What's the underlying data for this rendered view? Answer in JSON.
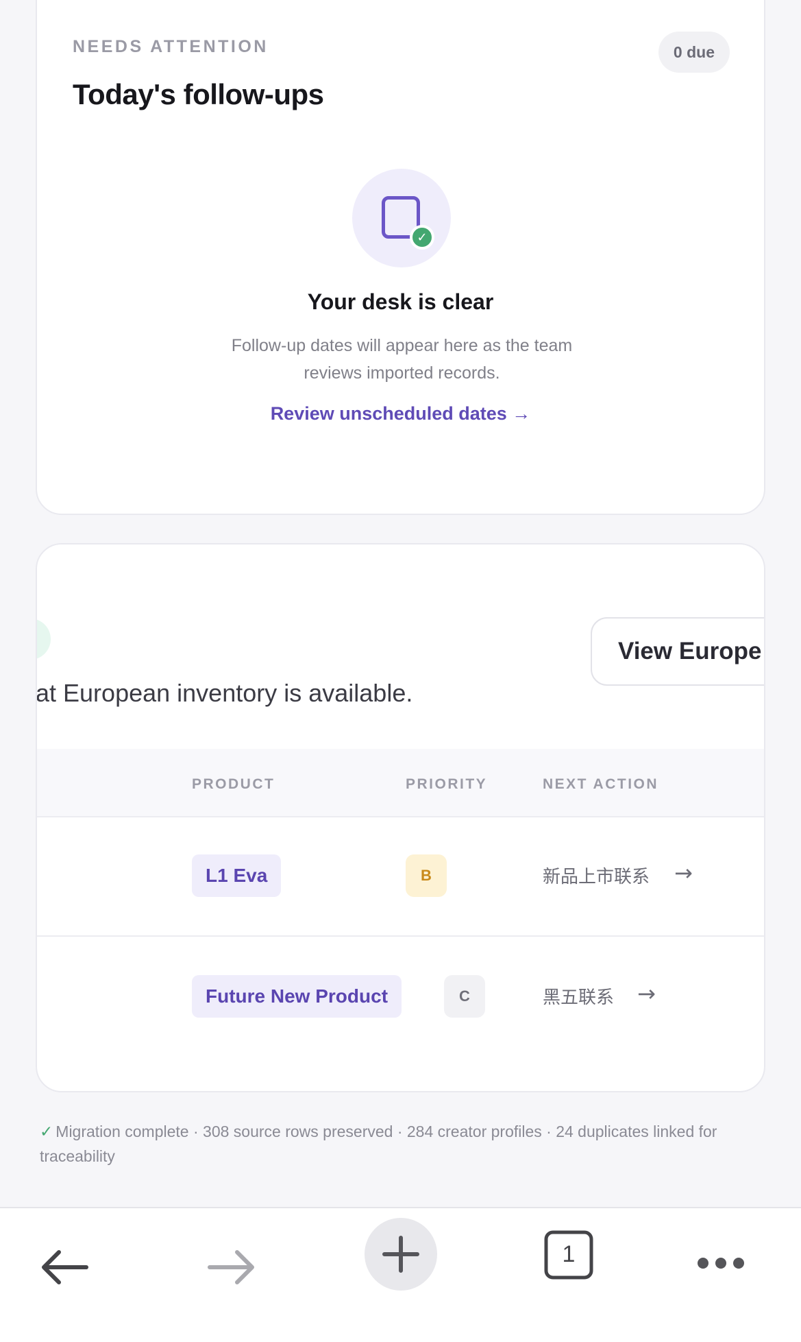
{
  "followups": {
    "eyebrow": "NEEDS ATTENTION",
    "title": "Today's follow-ups",
    "due_badge": "0 due",
    "empty_title": "Your desk is clear",
    "empty_text": "Follow-up dates will appear here as the team reviews imported records.",
    "review_link": "Review unscheduled dates →"
  },
  "europe": {
    "view_button": "View Europe →",
    "notice": "at European inventory is available."
  },
  "table": {
    "headers": {
      "product": "PRODUCT",
      "priority": "PRIORITY",
      "next_action": "NEXT ACTION"
    },
    "rows": [
      {
        "product": "L1 Eva",
        "priority": "B",
        "next_action": "新品上市联系",
        "arrow": "→"
      },
      {
        "product": "Future New Product",
        "priority": "C",
        "next_action": "黑五联系",
        "arrow": "→"
      }
    ]
  },
  "footer": {
    "check": "✓",
    "note": "Migration complete · 308 source rows preserved · 284 creator profiles · 24 duplicates linked for traceability"
  },
  "browser": {
    "tab_count": "1",
    "icons": [
      "back-arrow-icon",
      "forward-arrow-icon",
      "plus-icon",
      "tabs-icon",
      "more-icon"
    ]
  },
  "colors": {
    "accent": "#5f4bb6",
    "success": "#43a770",
    "priority_b": "#c98a1a"
  }
}
